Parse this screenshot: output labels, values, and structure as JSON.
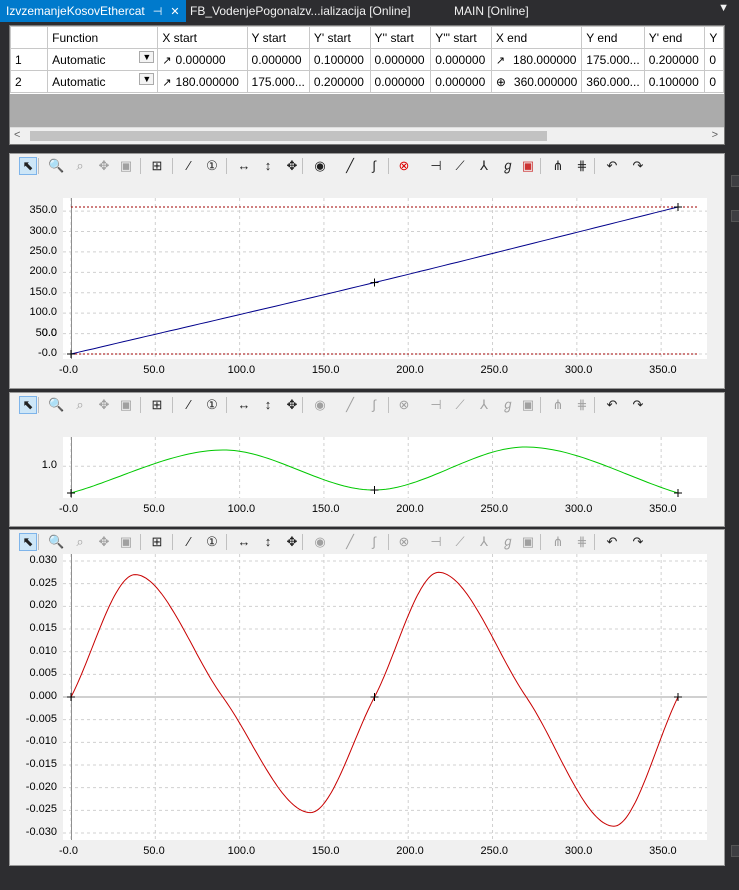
{
  "tabs": [
    {
      "label": "IzvzemanjeKosovEthercat",
      "active": true,
      "pin": "⊣",
      "close": "✕"
    },
    {
      "label": "FB_VodenjePogonalzv...ializacija [Online]",
      "active": false
    },
    {
      "label": "MAIN [Online]",
      "active": false
    }
  ],
  "tab_menu_icon": "dropdown-icon",
  "table": {
    "headers": [
      "",
      "Function",
      "X start",
      "Y start",
      "Y' start",
      "Y'' start",
      "Y''' start",
      "X end",
      "Y end",
      "Y' end",
      "Y"
    ],
    "rows": [
      {
        "num": "1",
        "function": "Automatic",
        "x_start": "0.000000",
        "y_start": "0.000000",
        "yp_start": "0.100000",
        "ypp_start": "0.000000",
        "yppp_start": "0.000000",
        "x_end": "180.000000",
        "y_end": "175.000...",
        "yp_end": "0.200000",
        "extra": "0"
      },
      {
        "num": "2",
        "function": "Automatic",
        "x_start": "180.000000",
        "y_start": "175.000...",
        "yp_start": "0.200000",
        "ypp_start": "0.000000",
        "yppp_start": "0.000000",
        "x_end": "360.000000",
        "y_end": "360.000...",
        "yp_end": "0.100000",
        "extra": "0"
      }
    ]
  },
  "x_ticks": [
    "-0.0",
    "50.0",
    "100.0",
    "150.0",
    "200.0",
    "250.0",
    "300.0",
    "350.0"
  ],
  "chart_data": [
    {
      "type": "line",
      "xlim": [
        -5,
        380
      ],
      "ylim": [
        -5,
        370
      ],
      "y_ticks": [
        "350.0",
        "300.0",
        "250.0",
        "200.0",
        "150.0",
        "100.0",
        "50.0",
        "0.0",
        "-0.0"
      ],
      "series": [
        {
          "color": "#00008b",
          "x": [
            0,
            180,
            360
          ],
          "y": [
            0,
            175,
            360
          ]
        }
      ],
      "limit_lines": [
        0,
        360
      ],
      "markers": [
        [
          0,
          0
        ],
        [
          180,
          175
        ],
        [
          360,
          360
        ]
      ]
    },
    {
      "type": "line",
      "xlim": [
        -5,
        380
      ],
      "ylim": [
        0.06,
        1.8
      ],
      "y_ticks": [
        "1.0"
      ],
      "series": [
        {
          "color": "#00c800",
          "x": [
            0,
            90,
            180,
            270,
            360
          ],
          "y": [
            0.1,
            1.55,
            0.2,
            1.65,
            0.1
          ]
        }
      ],
      "markers": [
        [
          0,
          0.1
        ],
        [
          180,
          0.2
        ],
        [
          360,
          0.1
        ]
      ]
    },
    {
      "type": "line",
      "xlim": [
        -5,
        380
      ],
      "ylim": [
        -0.031,
        0.031
      ],
      "y_ticks": [
        "0.030",
        "0.025",
        "0.020",
        "0.015",
        "0.010",
        "0.005",
        "0.000",
        "-0.005",
        "-0.010",
        "-0.015",
        "-0.020",
        "-0.025",
        "-0.030"
      ],
      "series": [
        {
          "color": "#c80000",
          "x": [
            0,
            38,
            90,
            142,
            180,
            218,
            270,
            322,
            360
          ],
          "y": [
            0,
            0.027,
            0,
            -0.0255,
            0,
            0.0275,
            0,
            -0.0285,
            0
          ]
        }
      ],
      "markers": [
        [
          0,
          0
        ],
        [
          180,
          0
        ],
        [
          360,
          0
        ]
      ]
    }
  ],
  "toolbar_icons": [
    "select-pointer-icon",
    "zoom-icon",
    "zoom-fit-icon",
    "pan-icon",
    "camera-icon",
    "grid-toggle-icon",
    "magic-wand-icon",
    "number-one-icon",
    "stretch-horizontal-icon",
    "stretch-vertical-icon",
    "move-all-icon",
    "point-icon",
    "line-icon",
    "curve-icon",
    "delete-icon",
    "cut-icon",
    "knife-icon",
    "split-icon",
    "bend-icon",
    "stop-icon",
    "mirror-icon",
    "mirror-down-icon",
    "undo-icon",
    "redo-icon"
  ]
}
